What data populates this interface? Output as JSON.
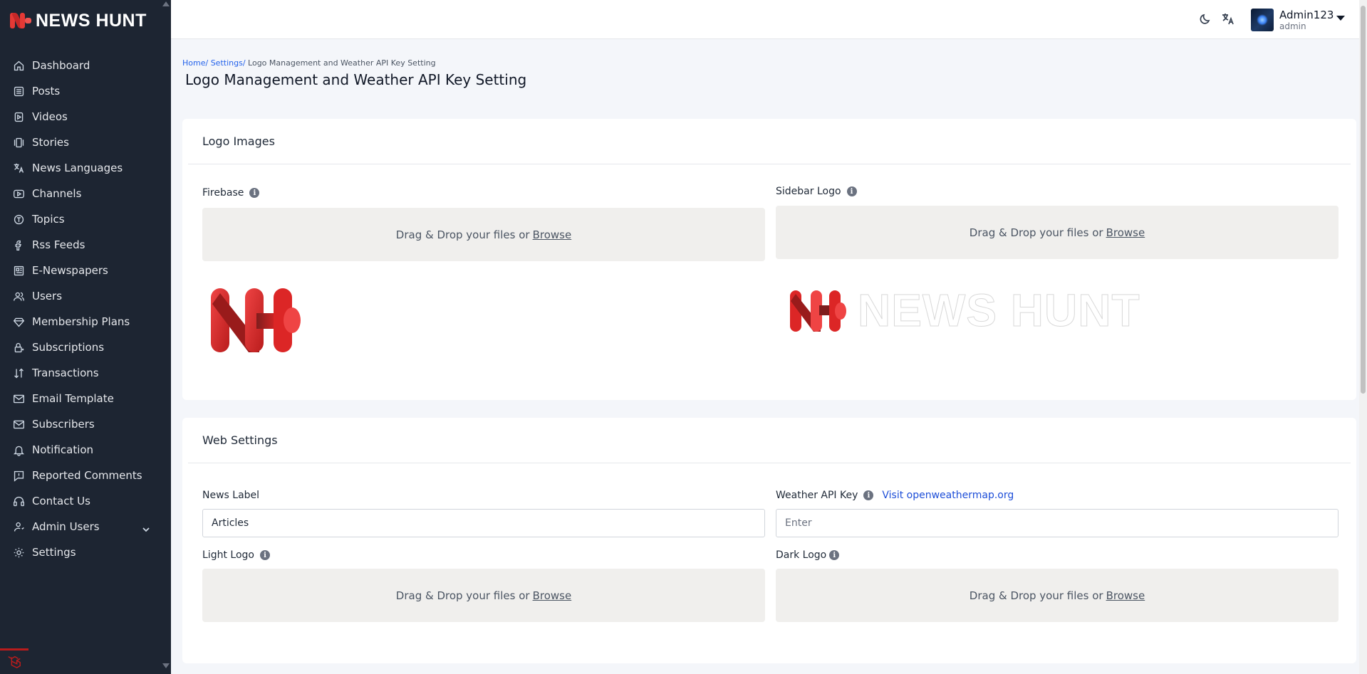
{
  "brand": {
    "name": "NEWS HUNT",
    "accent": "#e53935"
  },
  "sidebar": {
    "items": [
      {
        "label": "Dashboard",
        "icon": "home-icon"
      },
      {
        "label": "Posts",
        "icon": "list-icon"
      },
      {
        "label": "Videos",
        "icon": "video-icon"
      },
      {
        "label": "Stories",
        "icon": "stories-icon"
      },
      {
        "label": "News Languages",
        "icon": "translate-icon"
      },
      {
        "label": "Channels",
        "icon": "channel-icon"
      },
      {
        "label": "Topics",
        "icon": "topic-icon"
      },
      {
        "label": "Rss Feeds",
        "icon": "rss-icon"
      },
      {
        "label": "E-Newspapers",
        "icon": "newspaper-icon"
      },
      {
        "label": "Users",
        "icon": "users-icon"
      },
      {
        "label": "Membership Plans",
        "icon": "diamond-icon"
      },
      {
        "label": "Subscriptions",
        "icon": "lock-icon"
      },
      {
        "label": "Transactions",
        "icon": "transactions-icon"
      },
      {
        "label": "Email Template",
        "icon": "mail-icon"
      },
      {
        "label": "Subscribers",
        "icon": "mail-icon"
      },
      {
        "label": "Notification",
        "icon": "bell-icon"
      },
      {
        "label": "Reported Comments",
        "icon": "comment-alert-icon"
      },
      {
        "label": "Contact Us",
        "icon": "headset-icon"
      },
      {
        "label": "Admin Users",
        "icon": "admin-user-icon"
      },
      {
        "label": "Settings",
        "icon": "gear-icon"
      }
    ]
  },
  "topbar": {
    "user_name": "Admin123",
    "user_role": "admin"
  },
  "breadcrumb": {
    "home": "Home/",
    "settings": " Settings/",
    "current": " Logo Management and Weather API Key Setting"
  },
  "page": {
    "title": "Logo Management and Weather API Key Setting"
  },
  "logo_images": {
    "title": "Logo Images",
    "firebase_label": "Firebase",
    "sidebar_logo_label": "Sidebar Logo",
    "drop_text": "Drag & Drop your files or",
    "browse": "Browse",
    "wide_logo_text": "NEWS HUNT"
  },
  "web_settings": {
    "title": "Web Settings",
    "news_label_label": "News Label",
    "news_label_value": "Articles",
    "weather_label": "Weather API Key",
    "weather_link": "Visit openweathermap.org",
    "weather_placeholder": "Enter",
    "light_logo_label": "Light Logo",
    "dark_logo_label": "Dark Logo",
    "drop_text": "Drag & Drop your files or",
    "browse": "Browse"
  }
}
